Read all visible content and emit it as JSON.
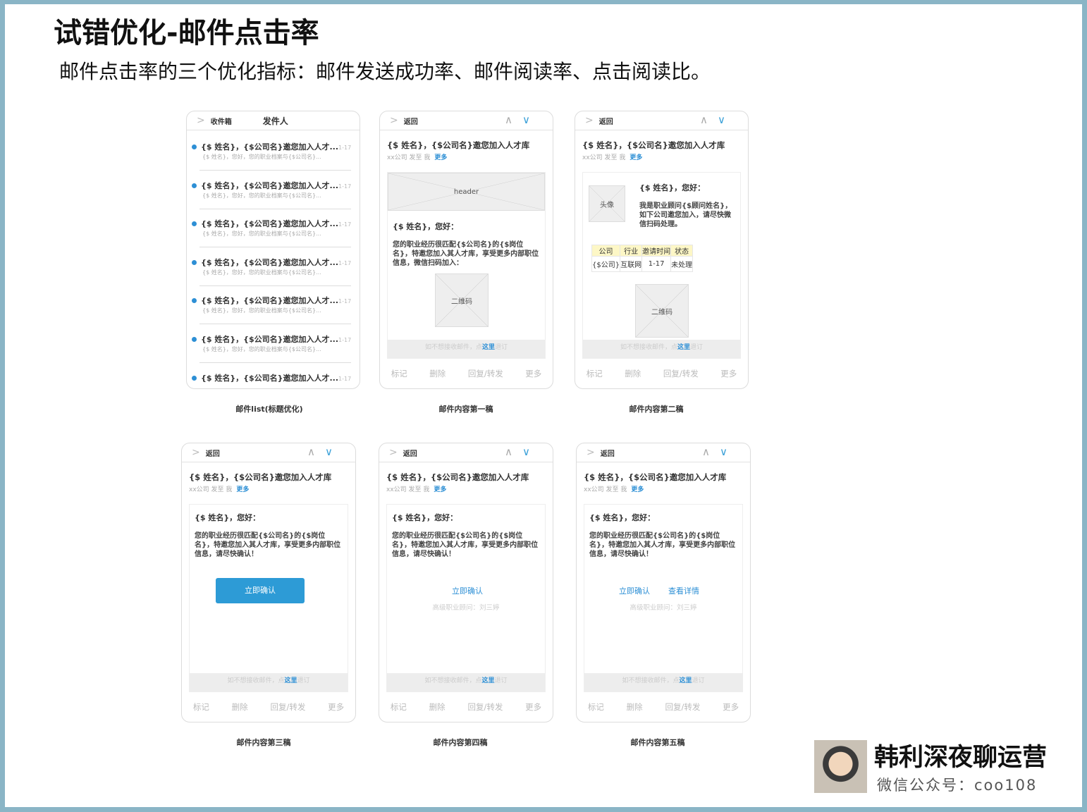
{
  "title": "试错优化-邮件点击率",
  "subtitle": "邮件点击率的三个优化指标：邮件发送成功率、邮件阅读率、点击阅读比。",
  "common": {
    "back": "返回",
    "subject": "{$ 姓名}，{$公司名}邀您加入人才库",
    "meta": "xx公司  发至  我",
    "more": "更多",
    "greeting": "{$ 姓名}，您好：",
    "unsub_pre": "如不想接收邮件，点",
    "unsub_link": "这里",
    "unsub_post": "退订",
    "toolbar": [
      "标记",
      "删除",
      "回复/转发",
      "更多"
    ],
    "qr": "二维码",
    "para_confirm": "您的职业经历很匹配{$公司名}的{$岗位名}，特邀您加入其人才库，享受更多内部职位信息，请尽快确认！",
    "advisor": "高级职业顾问：刘三婷"
  },
  "list": {
    "tab_inbox": "收件箱",
    "tab_sender": "发件人",
    "item_title": "{$ 姓名}，{$公司名}邀您加入人才...",
    "item_date": "1-17",
    "item_preview": "{$ 姓名}，您好，您的职业档案与{$公司名}...",
    "count": 7,
    "caption": "邮件list(标题优化)"
  },
  "v1": {
    "header": "header",
    "para": "您的职业经历很匹配{$公司名}的{$岗位名}，特邀您加入其人才库，享受更多内部职位信息，微信扫码加入：",
    "caption": "邮件内容第一稿"
  },
  "v2": {
    "avatar": "头像",
    "para": "我是职业顾问{$顾问姓名}，如下公司邀您加入，请尽快微信扫码处理。",
    "table_headers": [
      "公司",
      "行业",
      "邀请时间",
      "状态"
    ],
    "table_row": [
      "{$公司}",
      "互联网",
      "1-17",
      "未处理"
    ],
    "caption": "邮件内容第二稿"
  },
  "v3": {
    "button": "立即确认",
    "caption": "邮件内容第三稿"
  },
  "v4": {
    "link": "立即确认",
    "caption": "邮件内容第四稿"
  },
  "v5": {
    "link1": "立即确认",
    "link2": "查看详情",
    "caption": "邮件内容第五稿"
  },
  "brand": {
    "name": "韩利深夜聊运营",
    "sub": "微信公众号：coo108"
  },
  "colors": {
    "accent": "#2d9bd6",
    "border": "#8ab5c6"
  }
}
